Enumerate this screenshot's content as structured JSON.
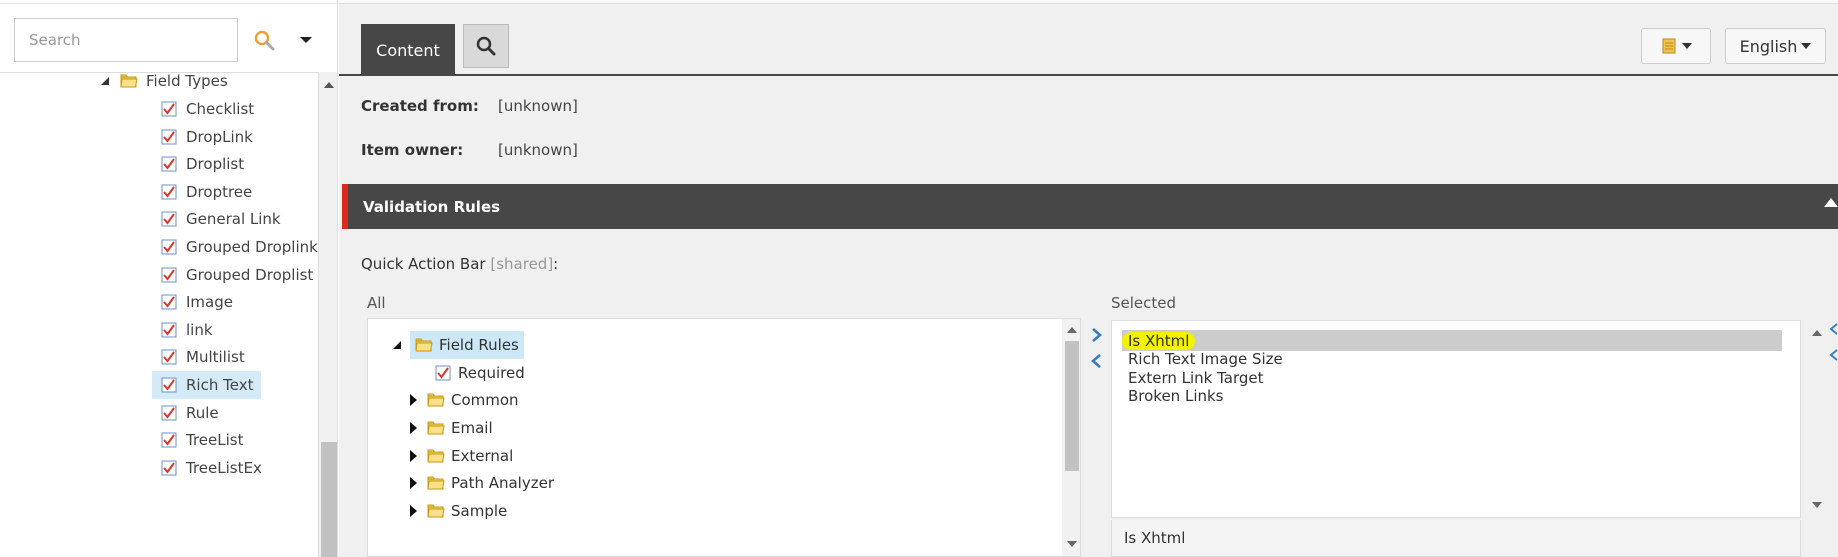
{
  "search": {
    "placeholder": "Search"
  },
  "left_tree": {
    "folder": "Field Types",
    "items": [
      "Checklist",
      "DropLink",
      "Droplist",
      "Droptree",
      "General Link",
      "Grouped Droplink",
      "Grouped Droplist",
      "Image",
      "link",
      "Multilist",
      "Rich Text",
      "Rule",
      "TreeList",
      "TreeListEx"
    ],
    "selected": "Rich Text"
  },
  "tabs": {
    "content": "Content"
  },
  "language": "English",
  "info": {
    "created_from_label": "Created from:",
    "created_from_value": "[unknown]",
    "item_owner_label": "Item owner:",
    "item_owner_value": "[unknown]"
  },
  "section": {
    "title": "Validation Rules"
  },
  "field": {
    "label": "Quick Action Bar",
    "shared": "[shared]",
    "colon": ":"
  },
  "all_list": {
    "label": "All",
    "root": "Field Rules",
    "leaf": "Required",
    "folders": [
      "Common",
      "Email",
      "External",
      "Path Analyzer",
      "Sample"
    ]
  },
  "selected_list": {
    "label": "Selected",
    "items": [
      "Is Xhtml",
      "Rich Text Image Size",
      "Extern Link Target",
      "Broken Links"
    ],
    "selected": "Is Xhtml",
    "footer": "Is Xhtml"
  },
  "colors": {
    "dark_bar": "#474747",
    "section_accent": "#dc291e",
    "selection_blue": "#d4ebf7",
    "highlight_yellow": "#f3f300"
  }
}
